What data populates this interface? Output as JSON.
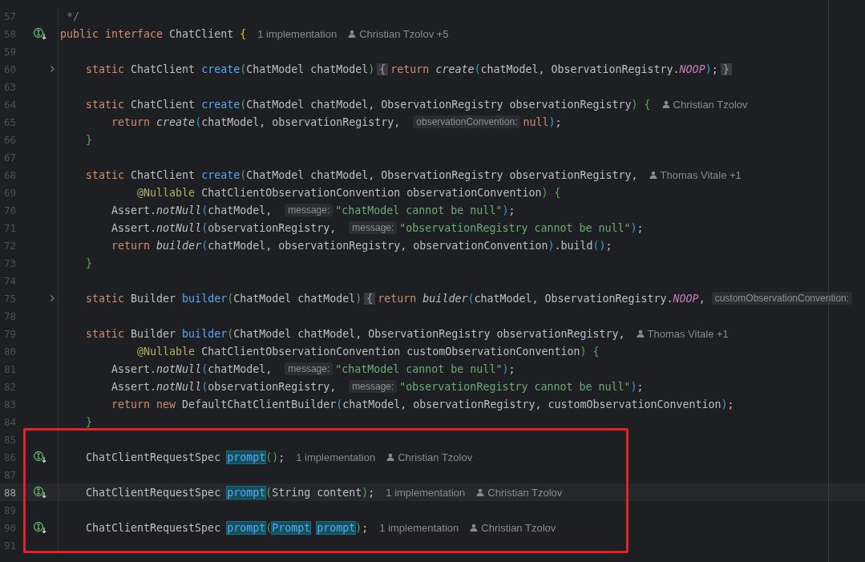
{
  "editor": {
    "lines": [
      {
        "number": "57",
        "current": false,
        "tokens": [
          {
            "text": " */",
            "kind": "comment"
          }
        ]
      },
      {
        "number": "58",
        "current": false,
        "gutter": {
          "kind": "implemented"
        },
        "tokens": [
          {
            "text": "public interface ",
            "kind": "kw"
          },
          {
            "text": "ChatClient ",
            "kind": "plain"
          },
          {
            "text": "{",
            "kind": "p1"
          },
          {
            "text": "1 implementation",
            "kind": "meta"
          },
          {
            "text": "Christian Tzolov +5",
            "kind": "author"
          }
        ]
      },
      {
        "number": "59",
        "current": false
      },
      {
        "number": "60",
        "current": false,
        "gutter": {
          "kind": "fold"
        },
        "tokens": [
          {
            "text": "    static ",
            "kind": "kw"
          },
          {
            "text": "ChatClient ",
            "kind": "plain"
          },
          {
            "text": "create",
            "kind": "decl"
          },
          {
            "text": "(",
            "kind": "p2"
          },
          {
            "text": "ChatModel chatModel",
            "kind": "plain"
          },
          {
            "text": ")",
            "kind": "p2"
          },
          {
            "text": "{",
            "kind": "fold"
          },
          {
            "text": "return ",
            "kind": "kw"
          },
          {
            "text": "create",
            "kind": "call"
          },
          {
            "text": "(",
            "kind": "p3"
          },
          {
            "text": "chatModel, ObservationRegistry.",
            "kind": "plain"
          },
          {
            "text": "NOOP",
            "kind": "const"
          },
          {
            "text": ")",
            "kind": "p3"
          },
          {
            "text": ";",
            "kind": "plain"
          },
          {
            "text": "}",
            "kind": "fold"
          }
        ]
      },
      {
        "number": "63",
        "current": false
      },
      {
        "number": "64",
        "current": false,
        "tokens": [
          {
            "text": "    static ",
            "kind": "kw"
          },
          {
            "text": "ChatClient ",
            "kind": "plain"
          },
          {
            "text": "create",
            "kind": "decl"
          },
          {
            "text": "(",
            "kind": "p2"
          },
          {
            "text": "ChatModel chatModel, ObservationRegistry observationRegistry",
            "kind": "plain"
          },
          {
            "text": ")",
            "kind": "p2"
          },
          {
            "text": " {",
            "kind": "p2"
          },
          {
            "text": "Christian Tzolov",
            "kind": "author"
          }
        ]
      },
      {
        "number": "65",
        "current": false,
        "tokens": [
          {
            "text": "        return ",
            "kind": "kw"
          },
          {
            "text": "create",
            "kind": "call"
          },
          {
            "text": "(",
            "kind": "p3"
          },
          {
            "text": "chatModel, observationRegistry, ",
            "kind": "plain"
          },
          {
            "text": "observationConvention:",
            "kind": "hint"
          },
          {
            "text": "null",
            "kind": "kw"
          },
          {
            "text": ")",
            "kind": "p3"
          },
          {
            "text": ";",
            "kind": "plain"
          }
        ]
      },
      {
        "number": "66",
        "current": false,
        "tokens": [
          {
            "text": "    }",
            "kind": "p2"
          }
        ]
      },
      {
        "number": "67",
        "current": false
      },
      {
        "number": "68",
        "current": false,
        "tokens": [
          {
            "text": "    static ",
            "kind": "kw"
          },
          {
            "text": "ChatClient ",
            "kind": "plain"
          },
          {
            "text": "create",
            "kind": "decl"
          },
          {
            "text": "(",
            "kind": "p2"
          },
          {
            "text": "ChatModel chatModel, ObservationRegistry observationRegistry,",
            "kind": "plain"
          },
          {
            "text": "Thomas Vitale +1",
            "kind": "author"
          }
        ]
      },
      {
        "number": "69",
        "current": false,
        "tokens": [
          {
            "text": "            @Nullable ",
            "kind": "ann"
          },
          {
            "text": "ChatClientObservationConvention observationConvention",
            "kind": "plain"
          },
          {
            "text": ")",
            "kind": "p2"
          },
          {
            "text": " {",
            "kind": "p2"
          }
        ]
      },
      {
        "number": "70",
        "current": false,
        "tokens": [
          {
            "text": "        Assert.",
            "kind": "plain"
          },
          {
            "text": "notNull",
            "kind": "call"
          },
          {
            "text": "(",
            "kind": "p3"
          },
          {
            "text": "chatModel, ",
            "kind": "plain"
          },
          {
            "text": "message:",
            "kind": "hint"
          },
          {
            "text": "\"chatModel cannot be null\"",
            "kind": "str"
          },
          {
            "text": ")",
            "kind": "p3"
          },
          {
            "text": ";",
            "kind": "plain"
          }
        ]
      },
      {
        "number": "71",
        "current": false,
        "tokens": [
          {
            "text": "        Assert.",
            "kind": "plain"
          },
          {
            "text": "notNull",
            "kind": "call"
          },
          {
            "text": "(",
            "kind": "p3"
          },
          {
            "text": "observationRegistry, ",
            "kind": "plain"
          },
          {
            "text": "message:",
            "kind": "hint"
          },
          {
            "text": "\"observationRegistry cannot be null\"",
            "kind": "str"
          },
          {
            "text": ")",
            "kind": "p3"
          },
          {
            "text": ";",
            "kind": "plain"
          }
        ]
      },
      {
        "number": "72",
        "current": false,
        "tokens": [
          {
            "text": "        return ",
            "kind": "kw"
          },
          {
            "text": "builder",
            "kind": "call"
          },
          {
            "text": "(",
            "kind": "p3"
          },
          {
            "text": "chatModel, observationRegistry, observationConvention",
            "kind": "plain"
          },
          {
            "text": ")",
            "kind": "p3"
          },
          {
            "text": ".build",
            "kind": "plain"
          },
          {
            "text": "()",
            "kind": "p3"
          },
          {
            "text": ";",
            "kind": "plain"
          }
        ]
      },
      {
        "number": "73",
        "current": false,
        "tokens": [
          {
            "text": "    }",
            "kind": "p2"
          }
        ]
      },
      {
        "number": "74",
        "current": false
      },
      {
        "number": "75",
        "current": false,
        "gutter": {
          "kind": "fold"
        },
        "tokens": [
          {
            "text": "    static ",
            "kind": "kw"
          },
          {
            "text": "Builder ",
            "kind": "plain"
          },
          {
            "text": "builder",
            "kind": "decl"
          },
          {
            "text": "(",
            "kind": "p2"
          },
          {
            "text": "ChatModel chatModel",
            "kind": "plain"
          },
          {
            "text": ")",
            "kind": "p2"
          },
          {
            "text": "{",
            "kind": "fold"
          },
          {
            "text": "return ",
            "kind": "kw"
          },
          {
            "text": "builder",
            "kind": "call"
          },
          {
            "text": "(",
            "kind": "p3"
          },
          {
            "text": "chatModel, ObservationRegistry.",
            "kind": "plain"
          },
          {
            "text": "NOOP",
            "kind": "const"
          },
          {
            "text": ",",
            "kind": "plain"
          },
          {
            "text": "customObservationConvention:",
            "kind": "hint"
          }
        ]
      },
      {
        "number": "78",
        "current": false
      },
      {
        "number": "79",
        "current": false,
        "tokens": [
          {
            "text": "    static ",
            "kind": "kw"
          },
          {
            "text": "Builder ",
            "kind": "plain"
          },
          {
            "text": "builder",
            "kind": "decl"
          },
          {
            "text": "(",
            "kind": "p2"
          },
          {
            "text": "ChatModel chatModel, ObservationRegistry observationRegistry,",
            "kind": "plain"
          },
          {
            "text": "Thomas Vitale +1",
            "kind": "author"
          }
        ]
      },
      {
        "number": "80",
        "current": false,
        "tokens": [
          {
            "text": "            @Nullable ",
            "kind": "ann"
          },
          {
            "text": "ChatClientObservationConvention customObservationConvention",
            "kind": "plain"
          },
          {
            "text": ")",
            "kind": "p2"
          },
          {
            "text": " {",
            "kind": "p2"
          }
        ]
      },
      {
        "number": "81",
        "current": false,
        "tokens": [
          {
            "text": "        Assert.",
            "kind": "plain"
          },
          {
            "text": "notNull",
            "kind": "call"
          },
          {
            "text": "(",
            "kind": "p3"
          },
          {
            "text": "chatModel, ",
            "kind": "plain"
          },
          {
            "text": "message:",
            "kind": "hint"
          },
          {
            "text": "\"chatModel cannot be null\"",
            "kind": "str"
          },
          {
            "text": ")",
            "kind": "p3"
          },
          {
            "text": ";",
            "kind": "plain"
          }
        ]
      },
      {
        "number": "82",
        "current": false,
        "tokens": [
          {
            "text": "        Assert.",
            "kind": "plain"
          },
          {
            "text": "notNull",
            "kind": "call"
          },
          {
            "text": "(",
            "kind": "p3"
          },
          {
            "text": "observationRegistry, ",
            "kind": "plain"
          },
          {
            "text": "message:",
            "kind": "hint"
          },
          {
            "text": "\"observationRegistry cannot be null\"",
            "kind": "str"
          },
          {
            "text": ")",
            "kind": "p3"
          },
          {
            "text": ";",
            "kind": "plain"
          }
        ]
      },
      {
        "number": "83",
        "current": false,
        "tokens": [
          {
            "text": "        return new ",
            "kind": "kw"
          },
          {
            "text": "DefaultChatClientBuilder",
            "kind": "plain"
          },
          {
            "text": "(",
            "kind": "p3"
          },
          {
            "text": "chatModel, observationRegistry, customObservationConvention",
            "kind": "plain"
          },
          {
            "text": ")",
            "kind": "p3"
          },
          {
            "text": ";",
            "kind": "plain"
          }
        ]
      },
      {
        "number": "84",
        "current": false,
        "tokens": [
          {
            "text": "    }",
            "kind": "p2"
          }
        ]
      },
      {
        "number": "85",
        "current": false
      },
      {
        "number": "86",
        "current": false,
        "gutter": {
          "kind": "implemented"
        },
        "tokens": [
          {
            "text": "    ChatClientRequestSpec ",
            "kind": "plain"
          },
          {
            "text": "prompt",
            "kind": "occ"
          },
          {
            "text": "()",
            "kind": "p2"
          },
          {
            "text": ";",
            "kind": "plain"
          },
          {
            "text": "1 implementation",
            "kind": "meta"
          },
          {
            "text": "Christian Tzolov",
            "kind": "author"
          }
        ]
      },
      {
        "number": "87",
        "current": false
      },
      {
        "number": "88",
        "current": true,
        "gutter": {
          "kind": "implemented"
        },
        "tokens": [
          {
            "text": "    ChatClientRequestSpec ",
            "kind": "plain"
          },
          {
            "text": "prompt",
            "kind": "occ"
          },
          {
            "text": "(",
            "kind": "p2"
          },
          {
            "text": "String content",
            "kind": "plain"
          },
          {
            "text": ")",
            "kind": "p2"
          },
          {
            "text": ";",
            "kind": "plain"
          },
          {
            "text": "1 implementation",
            "kind": "meta"
          },
          {
            "text": "Christian Tzolov",
            "kind": "author"
          }
        ]
      },
      {
        "number": "89",
        "current": false
      },
      {
        "number": "90",
        "current": false,
        "gutter": {
          "kind": "implemented"
        },
        "tokens": [
          {
            "text": "    ChatClientRequestSpec ",
            "kind": "plain"
          },
          {
            "text": "prompt",
            "kind": "occ"
          },
          {
            "text": "(",
            "kind": "p2"
          },
          {
            "text": "Prompt",
            "kind": "occ"
          },
          {
            "text": "prompt",
            "kind": "occ"
          },
          {
            "text": ")",
            "kind": "p2"
          },
          {
            "text": ";",
            "kind": "plain"
          },
          {
            "text": "1 implementation",
            "kind": "meta"
          },
          {
            "text": "Christian Tzolov",
            "kind": "author"
          }
        ]
      },
      {
        "number": "91",
        "current": false
      }
    ]
  }
}
